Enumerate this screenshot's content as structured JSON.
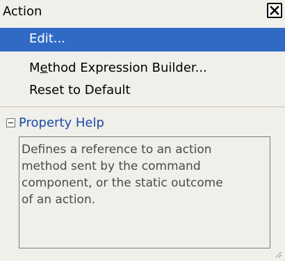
{
  "window": {
    "title": "Action"
  },
  "menu": {
    "items": [
      {
        "label": "Edit...",
        "selected": true
      },
      {
        "label_prefix": "M",
        "label_mnemonic": "e",
        "label_suffix": "thod Expression Builder...",
        "selected": false
      },
      {
        "label": "Reset to Default",
        "selected": false
      }
    ]
  },
  "help": {
    "title": "Property Help",
    "text": "Defines a reference to an action\nmethod sent by the command\ncomponent, or the static outcome\nof an action."
  },
  "icons": {
    "close": "close-icon",
    "collapse": "collapse-minus-icon",
    "grip": "resize-grip-icon"
  },
  "colors": {
    "selection": "#316ac5",
    "link": "#1a4aa8",
    "panel": "#f0efea"
  }
}
